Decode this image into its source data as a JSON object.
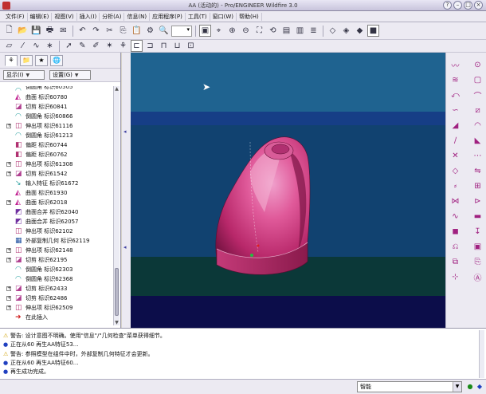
{
  "window": {
    "title": "AA (活动的) - Pro/ENGINEER Wildfire 3.0"
  },
  "menu": [
    "文件(F)",
    "编辑(E)",
    "视图(V)",
    "插入(I)",
    "分析(A)",
    "信息(N)",
    "应用程序(P)",
    "工具(T)",
    "窗口(W)",
    "帮助(H)"
  ],
  "toolbar": {
    "row1_icons": [
      "new-icon",
      "open-icon",
      "save-icon",
      "print-icon",
      "send-icon",
      "copy-icon",
      "paste-icon",
      "undo-icon",
      "redo-icon",
      "cut-icon",
      "regenerate-icon",
      "find-icon",
      "orient-icon",
      "spin-center-icon",
      "zoom-in-icon",
      "zoom-out-icon",
      "refit-icon",
      "reorient-icon",
      "view-manager-icon",
      "saved-views-icon",
      "layers-icon",
      "wireframe-icon",
      "hidden-line-icon",
      "no-hidden-icon",
      "shading-icon"
    ],
    "row2_icons": [
      "datum-plane-icon",
      "datum-axis-icon",
      "datum-curve-icon",
      "datum-point-icon",
      "coordinate-system-icon",
      "select-icon",
      "sketch-icon",
      "datum-plane-display-icon",
      "datum-axis-display-icon",
      "datum-point-display-icon",
      "csys-display-icon",
      "annotation-icon",
      "feature-icon",
      "model-tree-icon",
      "graph-icon"
    ]
  },
  "panel": {
    "show_label": "显示(I)",
    "settings_label": "设置(G)"
  },
  "tree": {
    "items": [
      {
        "label": "倒圆角 标识60505",
        "type": "round",
        "expand": ""
      },
      {
        "label": "曲面 标识60780",
        "type": "surface",
        "expand": ""
      },
      {
        "label": "切剪 标识60841",
        "type": "cut",
        "expand": ""
      },
      {
        "label": "倒圆角 标识60866",
        "type": "round",
        "expand": ""
      },
      {
        "label": "伸出项 标识61116",
        "type": "protrusion",
        "expand": "+"
      },
      {
        "label": "倒圆角 标识61213",
        "type": "round",
        "expand": ""
      },
      {
        "label": "偏距 标识60744",
        "type": "offset",
        "expand": ""
      },
      {
        "label": "偏距 标识60762",
        "type": "offset",
        "expand": ""
      },
      {
        "label": "伸出项 标识61308",
        "type": "protrusion",
        "expand": "+"
      },
      {
        "label": "切剪 标识61542",
        "type": "cut",
        "expand": "+"
      },
      {
        "label": "输入特征 标识61672",
        "type": "import",
        "expand": ""
      },
      {
        "label": "曲面 标识61930",
        "type": "surface",
        "expand": ""
      },
      {
        "label": "曲面 标识62018",
        "type": "surface",
        "expand": "+"
      },
      {
        "label": "曲面合并 标识62040",
        "type": "merge",
        "expand": ""
      },
      {
        "label": "曲面合并 标识62057",
        "type": "merge",
        "expand": ""
      },
      {
        "label": "伸出项 标识62102",
        "type": "protrusion",
        "expand": ""
      },
      {
        "label": "外部复制几何 标识62119",
        "type": "external",
        "expand": ""
      },
      {
        "label": "伸出项 标识62148",
        "type": "protrusion",
        "expand": "+"
      },
      {
        "label": "切剪 标识62195",
        "type": "cut",
        "expand": "+"
      },
      {
        "label": "倒圆角 标识62303",
        "type": "round",
        "expand": ""
      },
      {
        "label": "倒圆角 标识62368",
        "type": "round",
        "expand": ""
      },
      {
        "label": "切剪 标识62433",
        "type": "cut",
        "expand": "+"
      },
      {
        "label": "切剪 标识62486",
        "type": "cut",
        "expand": "+"
      },
      {
        "label": "伸出项 标识62509",
        "type": "protrusion",
        "expand": "+"
      },
      {
        "label": "在此插入",
        "type": "insert",
        "expand": ""
      }
    ]
  },
  "right_toolbar": [
    "sketch-tool-icon",
    "hole-icon",
    "extrude-icon",
    "shell-icon",
    "revolve-icon",
    "rib-icon",
    "sweep-icon",
    "draft-icon",
    "blend-icon",
    "round-icon",
    "curve-icon",
    "chamfer-icon",
    "boundary-blend-icon",
    "pattern-icon",
    "style-icon",
    "mirror-icon",
    "trim-icon",
    "merge-icon",
    "intersect-icon",
    "extend-icon",
    "offset-icon",
    "thicken-icon",
    "solidify-icon",
    "project-icon",
    "wrap-icon",
    "feature-group-icon",
    "copy-geom-icon",
    "publish-icon",
    "datum-ref-icon",
    "text-icon"
  ],
  "messages": [
    {
      "type": "warn",
      "text": "警告: 设计意图不明确。使用\"信息\"/\"几何检查\"菜单获得细节。"
    },
    {
      "type": "info",
      "text": "正在从60 再生AA特征53..."
    },
    {
      "type": "warn",
      "text": "警告: 参照模型在组件中时，外部复制几何特征才会更新。"
    },
    {
      "type": "info",
      "text": "正在从60 再生AA特征60..."
    },
    {
      "type": "info",
      "text": "再生成功完成。"
    }
  ],
  "status": {
    "filter_value": "智能"
  },
  "colors": {
    "viewport_top": "#1f6390",
    "viewport_bottom": "#0c0d4a",
    "model_main": "#c8306a",
    "model_highlight": "#e880b8",
    "accent": "#a02080"
  }
}
